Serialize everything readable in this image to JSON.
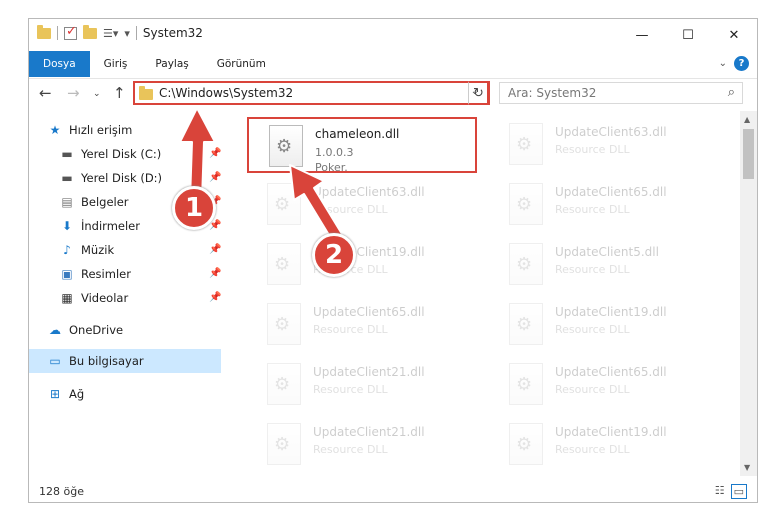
{
  "window": {
    "title": "System32",
    "controls": {
      "minimize": "—",
      "maximize": "☐",
      "close": "✕"
    }
  },
  "ribbon": {
    "tabs": [
      {
        "label": "Dosya",
        "active": true
      },
      {
        "label": "Giriş",
        "active": false
      },
      {
        "label": "Paylaş",
        "active": false
      },
      {
        "label": "Görünüm",
        "active": false
      }
    ],
    "help": "?"
  },
  "navigation": {
    "address": "C:\\Windows\\System32",
    "search_placeholder": "Ara: System32"
  },
  "sidebar": {
    "items": [
      {
        "label": "Hızlı erişim",
        "icon": "star-icon",
        "pinned": false
      },
      {
        "label": "Yerel Disk (C:)",
        "icon": "drive-icon",
        "pinned": true
      },
      {
        "label": "Yerel Disk (D:)",
        "icon": "drive-icon",
        "pinned": true
      },
      {
        "label": "Belgeler",
        "icon": "document-icon",
        "pinned": true
      },
      {
        "label": "İndirmeler",
        "icon": "download-icon",
        "pinned": true
      },
      {
        "label": "Müzik",
        "icon": "music-icon",
        "pinned": true
      },
      {
        "label": "Resimler",
        "icon": "picture-icon",
        "pinned": true
      },
      {
        "label": "Videolar",
        "icon": "video-icon",
        "pinned": true
      },
      {
        "label": "OneDrive",
        "icon": "cloud-icon",
        "pinned": false
      },
      {
        "label": "Bu bilgisayar",
        "icon": "computer-icon",
        "pinned": false,
        "selected": true
      },
      {
        "label": "Ağ",
        "icon": "network-icon",
        "pinned": false
      }
    ]
  },
  "files": [
    {
      "name": "chameleon.dll",
      "line2": "1.0.0.3",
      "line3": "Poker.",
      "highlighted": true
    },
    {
      "name": "UpdateClient63.dll",
      "line2": "Resource DLL"
    },
    {
      "name": "UpdateClient63.dll",
      "line2": "Resource DLL"
    },
    {
      "name": "UpdateClient65.dll",
      "line2": "Resource DLL"
    },
    {
      "name": "UpdateClient19.dll",
      "line2": "Resource DLL"
    },
    {
      "name": "UpdateClient5.dll",
      "line2": "Resource DLL"
    },
    {
      "name": "UpdateClient65.dll",
      "line2": "Resource DLL"
    },
    {
      "name": "UpdateClient19.dll",
      "line2": "Resource DLL"
    },
    {
      "name": "UpdateClient21.dll",
      "line2": "Resource DLL"
    },
    {
      "name": "UpdateClient65.dll",
      "line2": "Resource DLL"
    },
    {
      "name": "UpdateClient21.dll",
      "line2": "Resource DLL"
    },
    {
      "name": "UpdateClient19.dll",
      "line2": "Resource DLL"
    }
  ],
  "status": {
    "count": "128 öğe"
  },
  "annotations": {
    "step1": "1",
    "step2": "2",
    "color": "#d9443a"
  }
}
